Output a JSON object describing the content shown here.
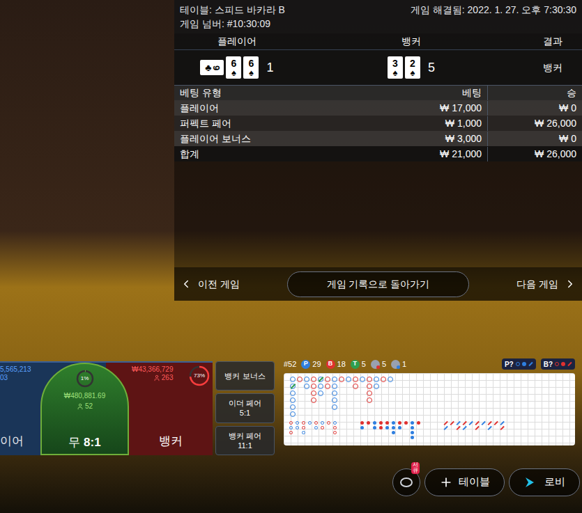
{
  "table_info": {
    "table": "테이블: 스피드 바카라 B",
    "resolved": "게임 해결됨: 2022. 1. 27. 오후 7:30:30",
    "game_number": "게임 넘버: #10:30:09"
  },
  "result": {
    "headers": [
      "플레이어",
      "뱅커",
      "결과"
    ],
    "player": {
      "cards": [
        {
          "rank": "9",
          "suit": "♣",
          "rotated": true
        },
        {
          "rank": "6",
          "suit": "♠",
          "rotated": false
        },
        {
          "rank": "6",
          "suit": "♠",
          "rotated": false
        }
      ],
      "score": "1"
    },
    "banker": {
      "cards": [
        {
          "rank": "3",
          "suit": "♠",
          "rotated": false
        },
        {
          "rank": "2",
          "suit": "♠",
          "rotated": false
        }
      ],
      "score": "5"
    },
    "winner": "뱅커"
  },
  "bets": {
    "headers": [
      "베팅 유형",
      "베팅",
      "승"
    ],
    "rows": [
      {
        "type": "플레이어",
        "bet": "₩ 17,000",
        "win": "₩ 0"
      },
      {
        "type": "퍼펙트 페어",
        "bet": "₩ 1,000",
        "win": "₩ 26,000"
      },
      {
        "type": "플레이어 보너스",
        "bet": "₩ 3,000",
        "win": "₩ 0"
      }
    ],
    "total": {
      "type": "합계",
      "bet": "₩ 21,000",
      "win": "₩ 26,000"
    }
  },
  "nav": {
    "prev": "이전 게임",
    "center": "게임 기록으로 돌아가기",
    "next": "다음 게임"
  },
  "spots": {
    "player": {
      "amount": "5,565,213",
      "count": "03",
      "label": "이어"
    },
    "tie": {
      "percent": "1%",
      "level": 0.01,
      "amount": "₩480,881.69",
      "count": "52",
      "label": "무",
      "odds": "8:1"
    },
    "banker": {
      "amount": "₩43,366,729",
      "count": "263",
      "percent": "73%",
      "level": 0.73,
      "label": "뱅커"
    }
  },
  "side_bets": [
    {
      "label": "뱅커 보너스",
      "odds": ""
    },
    {
      "label": "이더 페어",
      "odds": "5:1"
    },
    {
      "label": "뱅커 페어",
      "odds": "11:1"
    }
  ],
  "stats": {
    "total": "#52",
    "items": [
      {
        "label": "P",
        "value": "29",
        "color": "#2f7fe0"
      },
      {
        "label": "B",
        "value": "18",
        "color": "#e0312f"
      },
      {
        "label": "T",
        "value": "5",
        "color": "#2e9e4f"
      }
    ],
    "pairs": [
      {
        "value": "5",
        "color": "#e0312f"
      },
      {
        "value": "1",
        "color": "#2f7fe0"
      }
    ],
    "predictions": [
      {
        "label": "P?",
        "color": "#2f7fe0"
      },
      {
        "label": "B?",
        "color": "#e0312f"
      }
    ]
  },
  "big_road": [
    [
      "P",
      "PT",
      "P",
      "P",
      "P",
      "P"
    ],
    [
      "B"
    ],
    [
      "P",
      "P"
    ],
    [
      "B",
      "B",
      "B",
      "B"
    ],
    [
      "PT",
      "P",
      "P"
    ],
    [
      "B",
      "B"
    ],
    [
      "P",
      "P",
      "P",
      "P",
      "P"
    ],
    [
      "B"
    ],
    [
      "P"
    ],
    [
      "B",
      "B"
    ],
    [
      "P"
    ],
    [
      "B",
      "B",
      "B",
      "B"
    ],
    [
      "P",
      "P"
    ],
    [
      "B"
    ],
    [
      "P"
    ]
  ],
  "derived_roads": [
    {
      "kind": "ring",
      "columns": [
        [
          "B",
          "P",
          "B"
        ],
        [
          "P",
          "P"
        ],
        [
          "B",
          "B",
          "P"
        ],
        [
          "P"
        ],
        [
          "B",
          "P"
        ],
        [
          "P",
          "B"
        ],
        [
          "B"
        ],
        [
          "P",
          "B",
          "B"
        ]
      ]
    },
    {
      "kind": "dot",
      "columns": [
        [
          "B",
          "P"
        ],
        [
          "B"
        ],
        [
          "P",
          "P"
        ],
        [
          "B",
          "B"
        ],
        [
          "B",
          "P"
        ],
        [
          "P",
          "P",
          "P"
        ],
        [
          "B",
          "P"
        ],
        [
          "B"
        ],
        [
          "P",
          "P",
          "P",
          "P"
        ],
        [
          "B"
        ]
      ]
    },
    {
      "kind": "slash",
      "columns": [
        [
          "B",
          "P"
        ],
        [
          "B"
        ],
        [
          "P",
          "B"
        ],
        [
          "B",
          "P"
        ],
        [
          "P"
        ],
        [
          "B",
          "B"
        ],
        [
          "P"
        ],
        [
          "B",
          "P"
        ],
        [
          "B"
        ],
        [
          "P",
          "B"
        ]
      ]
    }
  ],
  "bottom_bar": {
    "chip_badge": "서큐",
    "buttons": [
      "테이블",
      "로비"
    ]
  }
}
